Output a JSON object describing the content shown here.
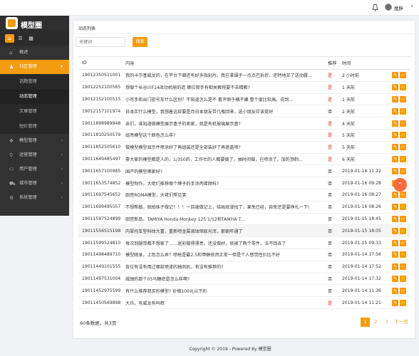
{
  "header": {
    "user_name": "魔胖",
    "caret": "▾"
  },
  "brand": {
    "name": "模型圈"
  },
  "quick_icons": [
    "home-icon",
    "list-icon",
    "grid-icon"
  ],
  "menu": {
    "items": [
      {
        "label": "概述",
        "icon": "home-icon"
      },
      {
        "label": "社区管理",
        "icon": "user-icon",
        "active": true
      },
      {
        "label": "模型管理",
        "icon": "cube-icon"
      },
      {
        "label": "运营管理",
        "icon": "link-icon"
      },
      {
        "label": "用户管理",
        "icon": "users-icon"
      },
      {
        "label": "城市管理",
        "icon": "cart-icon"
      },
      {
        "label": "系统管理",
        "icon": "settings-icon"
      }
    ],
    "sub_items": [
      {
        "label": "话题管理"
      },
      {
        "label": "动态管理",
        "current": true
      },
      {
        "label": "文章管理"
      },
      {
        "label": "短价管理"
      }
    ]
  },
  "panel": {
    "title": "动态列表"
  },
  "search": {
    "placeholder": "关键词",
    "button": "搜索"
  },
  "table": {
    "headers": [
      "ID",
      "内容",
      "推荐",
      "时间",
      ""
    ],
    "rows": [
      {
        "id": "19012350511001",
        "content": "我的卡尔基威龙的，在平台下面还有好多指刻片，我在拿镊子一点点巴拆状，还特地买了送动履...",
        "rec": "是",
        "time": "2 小时前"
      },
      {
        "id": "19012252100565",
        "content": "想做个长谷川F14改动机舱的造 哪位简手有相关教程要不去精教?",
        "rec": "是",
        "time": "1 天前"
      },
      {
        "id": "19012152100515",
        "content": "小可手和出门挺号车什么区别？不知道怎么是不 看评例于横不嫌 整个度比较高。说到...",
        "rec": "是",
        "time": "1 天前"
      },
      {
        "id": "19012157101974",
        "content": "日本买什么模型，我想着这款要是月日本朋友带几瓶回来，选小朋友应该挺好",
        "rec": "否",
        "time": "2 天前"
      },
      {
        "id": "19011898989948",
        "content": "亲们，谁知道做模型展示盒子的卖家，就是有机玻璃展示盒?",
        "rec": "是",
        "time": "4 天前"
      },
      {
        "id": "19011810250579",
        "content": "组亮模型这个颜色怎么样?",
        "rec": "是",
        "time": "5 天前"
      },
      {
        "id": "19011852505610",
        "content": "做模型模型显示件喷涂好了再组装还是全部装好了再遮盖喷?",
        "rec": "是",
        "time": "5 天前"
      },
      {
        "id": "19011649485497",
        "content": "豪大家的模型都是人的，1/350的，工作忙的人都要做了，抽时间做，在喷涂了，加的顶剃...",
        "rec": "是",
        "time": "6 天前"
      },
      {
        "id": "19011657100985",
        "content": "国产的模型哪家好?",
        "rec": "否",
        "time": "2019-01-16 11:22"
      },
      {
        "id": "19011653574852",
        "content": "模型制作，大佬们推荐哪个牌子的手涂丙烯颜料?",
        "rec": "否",
        "time": "2019-01-16 09:28"
      },
      {
        "id": "19011697545652",
        "content": "田宫ROMA模型，大佬们帮见笑",
        "rec": "否",
        "time": "2019-01-16 08:27"
      },
      {
        "id": "19011699495557",
        "content": "不想帮敲，就拍抹子做记！！！一目被做记上，结局就漫找了，果免已经，自免还是要挣扎一下!",
        "rec": "否",
        "time": "2019-01-16 08:26"
      },
      {
        "id": "19011597524899",
        "content": "田宫新品、TAMIYA Honda Monkey 125 1/12和TAMIYA T...",
        "rec": "否",
        "time": "2019-01-15 18:45"
      },
      {
        "id": "19011556515198",
        "content": "内翠托车型科体大重，重新喷金属液珐琅底光浑，那朝年通了",
        "rec": "否",
        "time": "2019-01-15 18:05"
      },
      {
        "id": "19011599524810",
        "content": "每次到腿带都不想家了……迷彩做得漂亮，还没做好，就被了两个零件，法不回去了",
        "rec": "否",
        "time": "2019-01-15 09:33"
      },
      {
        "id": "19011498489710",
        "content": "模型随录，上色怎么弄？喷枪是最2.5和甲醇依然正常一但是个人感觉性价比不好",
        "rec": "否",
        "time": "2019-01-14 17:56"
      },
      {
        "id": "19011449101555",
        "content": "各位有没有用过哪款喷漆的抽风机，有没有推荐的?",
        "rec": "否",
        "time": "2019-01-14 17:52"
      },
      {
        "id": "19011497531004",
        "content": "威驰的那个05马糖痣是怎么样啊?",
        "rec": "否",
        "time": "2019-01-14 17:32"
      },
      {
        "id": "19011452975599",
        "content": "有什么推荐我买的模型? 价格100元以下的",
        "rec": "否",
        "time": "2019-01-14 11:36"
      },
      {
        "id": "19011450569898",
        "content": "大兵，有威龙有吗辉",
        "rec": "是",
        "time": "2019-01-14 11:21"
      }
    ]
  },
  "summary": {
    "total_text": "60条数据，共3页"
  },
  "pagination": {
    "pages": [
      "1",
      "2",
      "3"
    ],
    "next": "下一页"
  },
  "footer": {
    "text": "Copyright © 2019 - Powered By 模型圈"
  },
  "colors": {
    "accent": "#f39c12",
    "sidebar": "#323232",
    "red": "#e0301e",
    "float": "#f66b3b"
  }
}
